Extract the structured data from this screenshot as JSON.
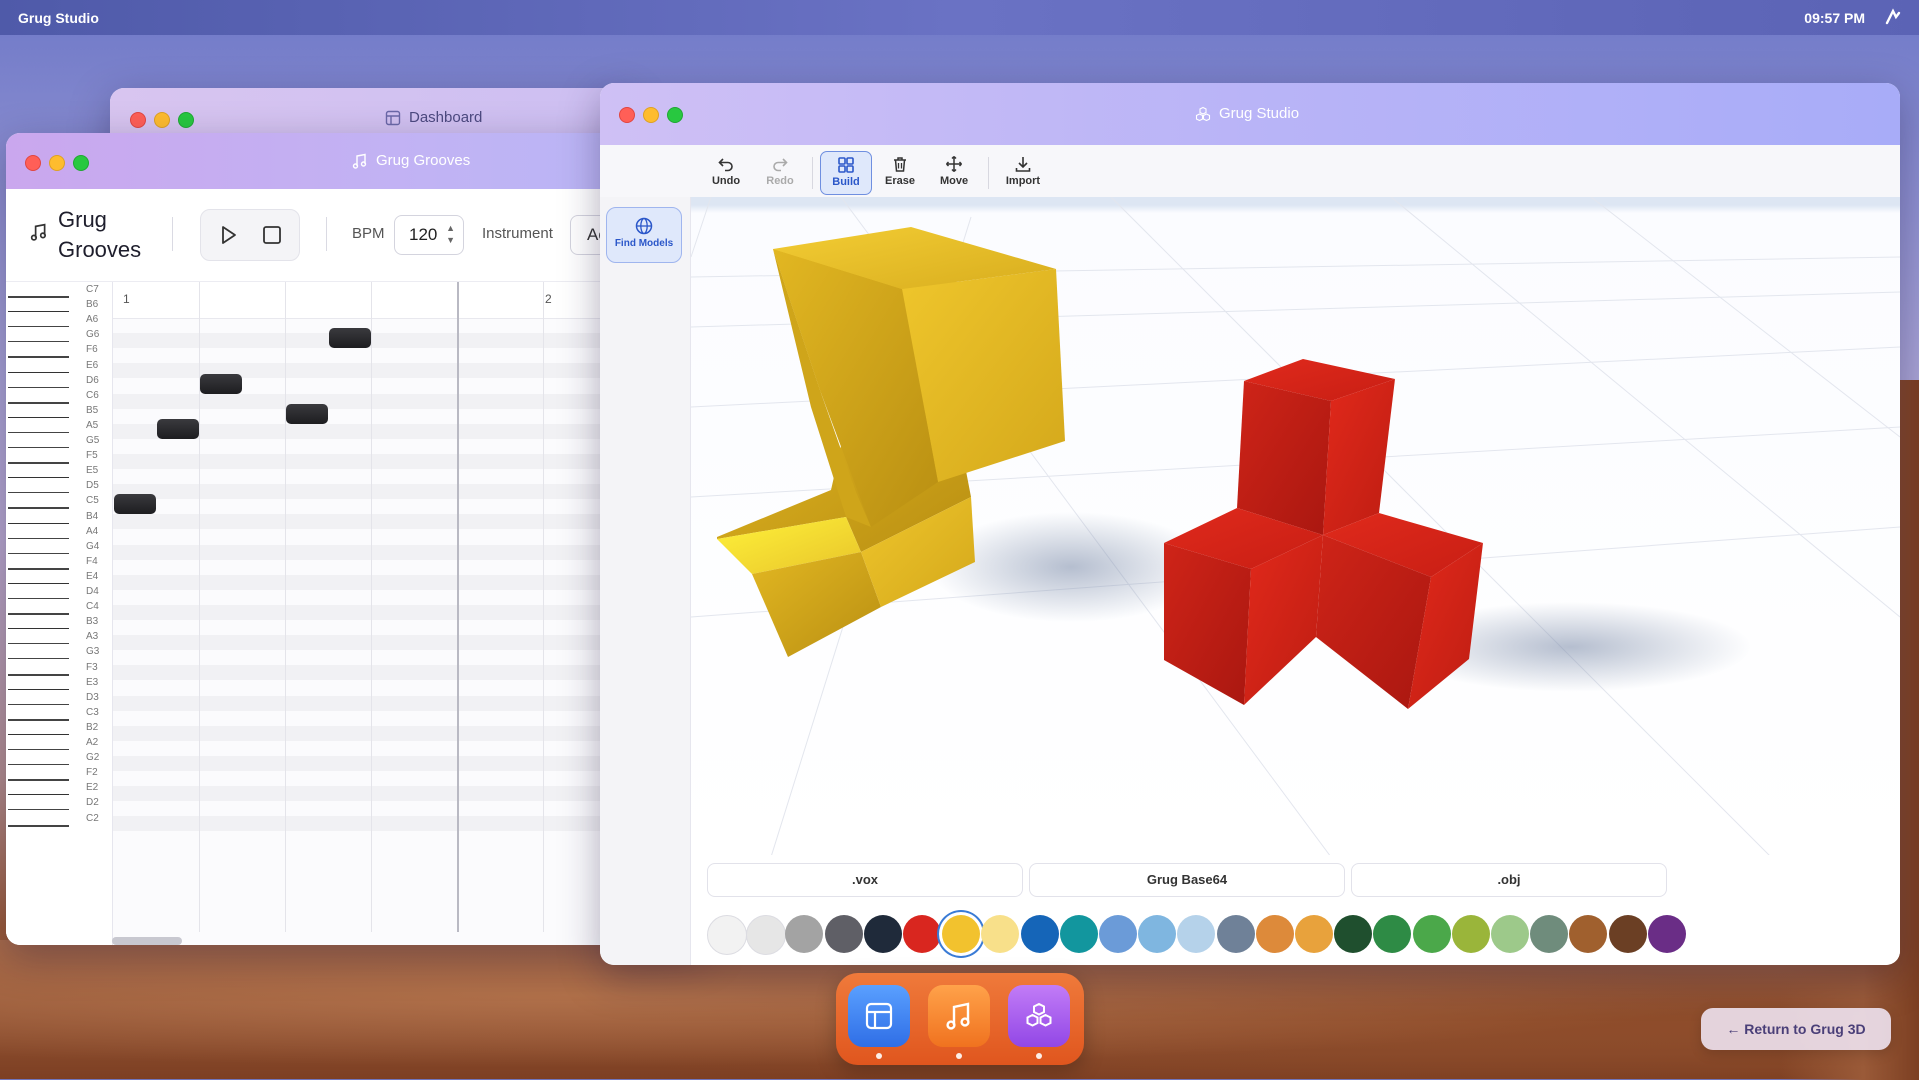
{
  "menubar": {
    "app_name": "Grug Studio",
    "clock": "09:57 PM"
  },
  "dashboard": {
    "title": "Dashboard"
  },
  "grooves": {
    "title": "Grug Grooves",
    "app_name": "Grug Grooves",
    "bpm_label": "BPM",
    "bpm_value": "120",
    "instrument_label": "Instrument",
    "instrument_value": "Ac",
    "measures": [
      "1",
      "2"
    ],
    "keys": [
      "C7",
      "B6",
      "A6",
      "G6",
      "F6",
      "E6",
      "D6",
      "C6",
      "B5",
      "A5",
      "G5",
      "F5",
      "E5",
      "D5",
      "C5",
      "B4",
      "A4",
      "G4",
      "F4",
      "E4",
      "D4",
      "C4",
      "B3",
      "A3",
      "G3",
      "F3",
      "E3",
      "D3",
      "C3",
      "B2",
      "A2",
      "G2",
      "F2",
      "E2",
      "D2",
      "C2"
    ],
    "notes": [
      {
        "pitch": "C5",
        "beat": 0
      },
      {
        "pitch": "A5",
        "beat": 1
      },
      {
        "pitch": "D6",
        "beat": 2
      },
      {
        "pitch": "B5",
        "beat": 4
      },
      {
        "pitch": "G6",
        "beat": 5
      }
    ]
  },
  "studio": {
    "title": "Grug Studio",
    "toolbar": {
      "undo": "Undo",
      "redo": "Redo",
      "build": "Build",
      "erase": "Erase",
      "move": "Move",
      "import": "Import"
    },
    "active_tool": "Build",
    "find_models": "Find Models",
    "exports": [
      ".vox",
      "Grug Base64",
      ".obj"
    ],
    "palette": [
      "#f2f2f2",
      "#e6e6e6",
      "#a3a3a3",
      "#5f5f66",
      "#1f2a3a",
      "#d9261f",
      "#f2c22e",
      "#f8e08a",
      "#1565b8",
      "#12969e",
      "#6b9bd8",
      "#7fb6e0",
      "#b5d2ea",
      "#6f8198",
      "#dd8a3a",
      "#e8a23c",
      "#1f4f2e",
      "#2e8b45",
      "#4ba84a",
      "#9ab53a",
      "#9dc98a",
      "#6f8c7c",
      "#a0602e",
      "#6b3f24",
      "#6a2d86"
    ],
    "selected_swatch": 6
  },
  "dock": {
    "apps": [
      "Dashboard",
      "Grug Grooves",
      "Grug Studio"
    ]
  },
  "return_button": "← Return to Grug 3D"
}
